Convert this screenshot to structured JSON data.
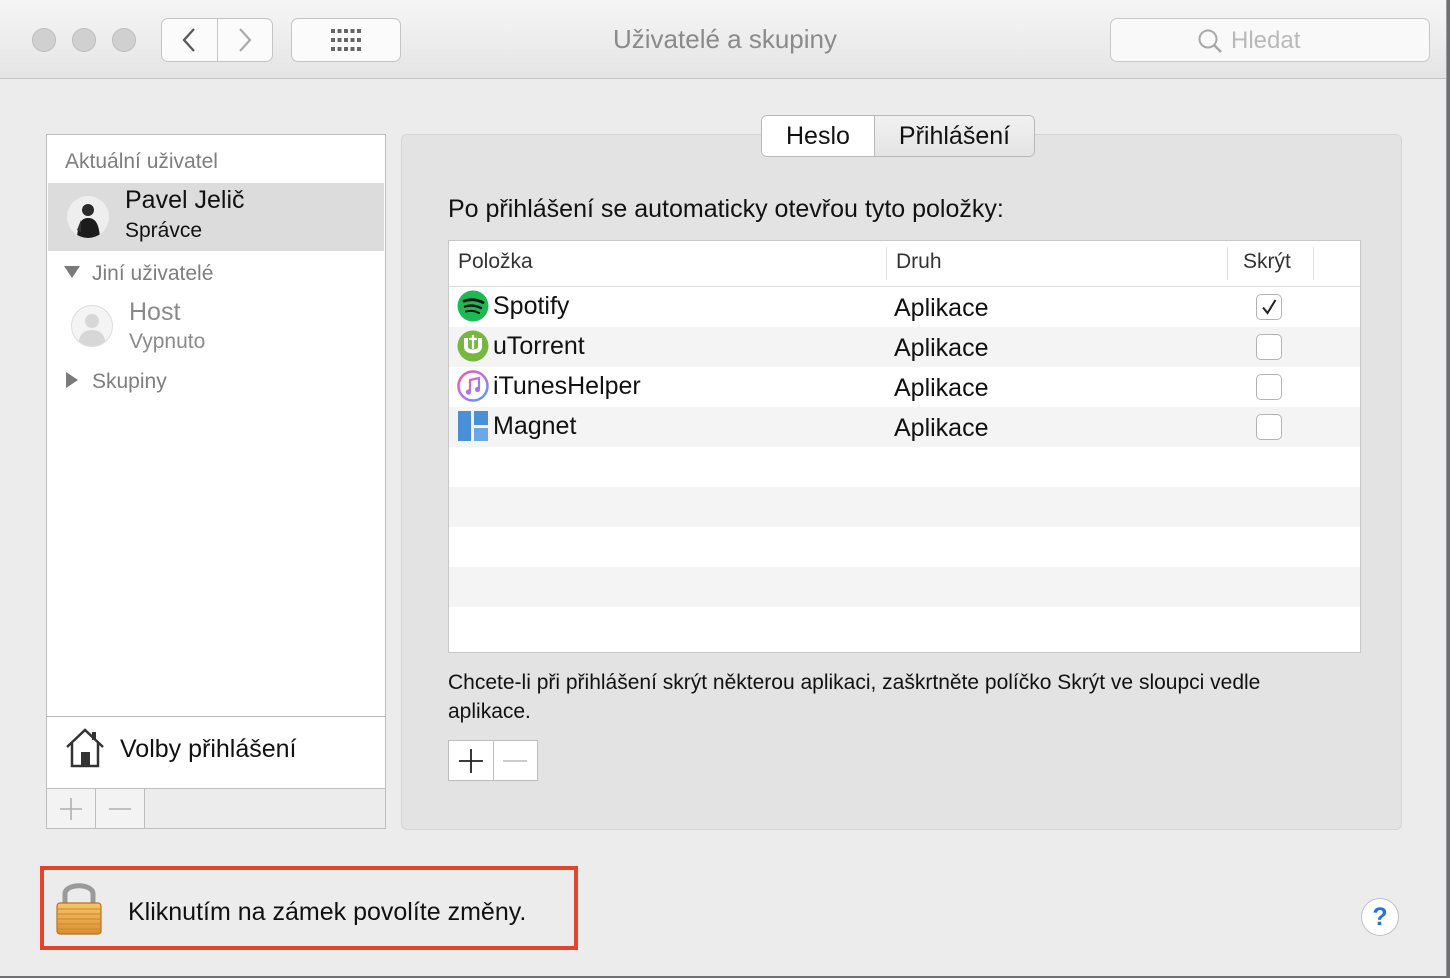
{
  "window": {
    "title": "Uživatelé a skupiny",
    "search_placeholder": "Hledat"
  },
  "sidebar": {
    "current_section": "Aktuální uživatel",
    "current_user": {
      "name": "Pavel Jelič",
      "role": "Správce"
    },
    "other_section": "Jiní uživatelé",
    "guest": {
      "name": "Host",
      "status": "Vypnuto"
    },
    "groups": "Skupiny",
    "login_options": "Volby přihlášení"
  },
  "tabs": [
    {
      "label": "Heslo",
      "selected": false
    },
    {
      "label": "Přihlášení",
      "selected": true
    }
  ],
  "login_items": {
    "heading": "Po přihlášení se automaticky otevřou tyto položky:",
    "columns": {
      "item": "Položka",
      "kind": "Druh",
      "hide": "Skrýt"
    },
    "rows": [
      {
        "name": "Spotify",
        "kind": "Aplikace",
        "hidden": true,
        "icon": "spotify-icon"
      },
      {
        "name": "uTorrent",
        "kind": "Aplikace",
        "hidden": false,
        "icon": "utorrent-icon"
      },
      {
        "name": "iTunesHelper",
        "kind": "Aplikace",
        "hidden": false,
        "icon": "itunes-icon"
      },
      {
        "name": "Magnet",
        "kind": "Aplikace",
        "hidden": false,
        "icon": "magnet-icon"
      }
    ],
    "hint": "Chcete-li při přihlášení skrýt některou aplikaci, zaškrtněte políčko Skrýt ve sloupci vedle aplikace."
  },
  "lock": {
    "text": "Kliknutím na zámek povolíte změny."
  },
  "colors": {
    "highlight_frame": "#e2442a",
    "help_accent": "#2a72d8",
    "spotify": "#1db954",
    "utorrent": "#76b83f",
    "magnet": "#4a90d9"
  }
}
